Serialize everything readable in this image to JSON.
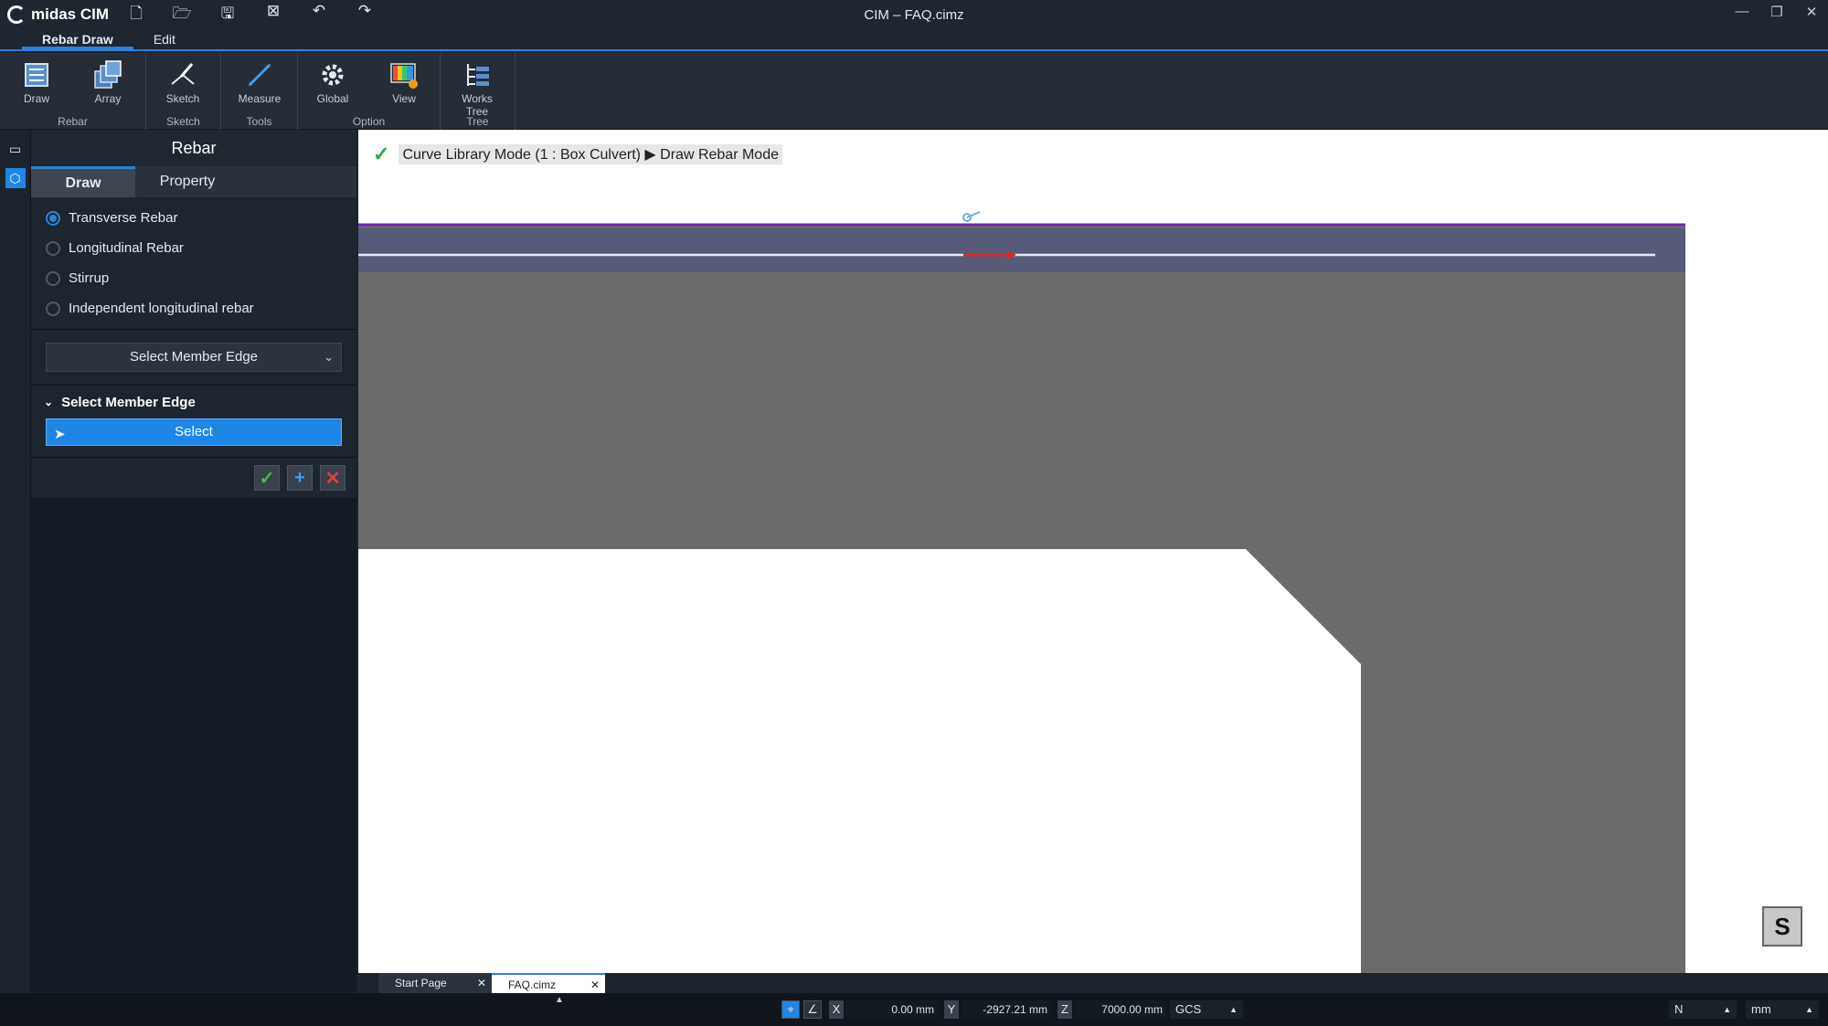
{
  "app": {
    "name": "midas CIM",
    "window_title": "CIM – FAQ.cimz"
  },
  "quick_access": [
    "new-file-icon",
    "open-folder-icon",
    "save-icon",
    "close-file-icon",
    "undo-icon",
    "redo-icon"
  ],
  "menu_tabs": [
    {
      "label": "Rebar Draw",
      "active": true
    },
    {
      "label": "Edit",
      "active": false
    }
  ],
  "ribbon": {
    "groups": [
      {
        "label": "Rebar",
        "buttons": [
          "Draw",
          "Array"
        ]
      },
      {
        "label": "Sketch",
        "buttons": [
          "Sketch"
        ]
      },
      {
        "label": "Tools",
        "buttons": [
          "Measure"
        ]
      },
      {
        "label": "Option",
        "buttons": [
          "Global",
          "View"
        ]
      },
      {
        "label": "Tree",
        "buttons": [
          "Works Tree"
        ]
      }
    ]
  },
  "panel": {
    "title": "Rebar",
    "tabs": [
      "Draw",
      "Property"
    ],
    "rebar_types": [
      {
        "label": "Transverse Rebar",
        "selected": true
      },
      {
        "label": "Longitudinal Rebar",
        "selected": false
      },
      {
        "label": "Stirrup",
        "selected": false
      },
      {
        "label": "Independent longitudinal rebar",
        "selected": false
      }
    ],
    "method_dropdown": "Select Member Edge",
    "section_title": "Select Member Edge",
    "select_button": "Select"
  },
  "viewport": {
    "breadcrumb_left": "Curve Library Mode (1 : Box Culvert)",
    "breadcrumb_right": "Draw Rebar Mode",
    "view_cube": "S",
    "colors": {
      "member_fill": "#6b6b6b",
      "top_edge": "#6c2bb5",
      "rebar_line": "#e6e8f4",
      "highlight": "#3f4a8a"
    }
  },
  "doc_tabs": [
    {
      "label": "Start Page",
      "active": false
    },
    {
      "label": "FAQ.cimz",
      "active": true
    }
  ],
  "status": {
    "x_label": "X",
    "x_value": "0.00 mm",
    "y_label": "Y",
    "y_value": "-2927.21 mm",
    "z_label": "Z",
    "z_value": "7000.00 mm",
    "coord_system": "GCS",
    "snap": "N",
    "unit": "mm"
  }
}
